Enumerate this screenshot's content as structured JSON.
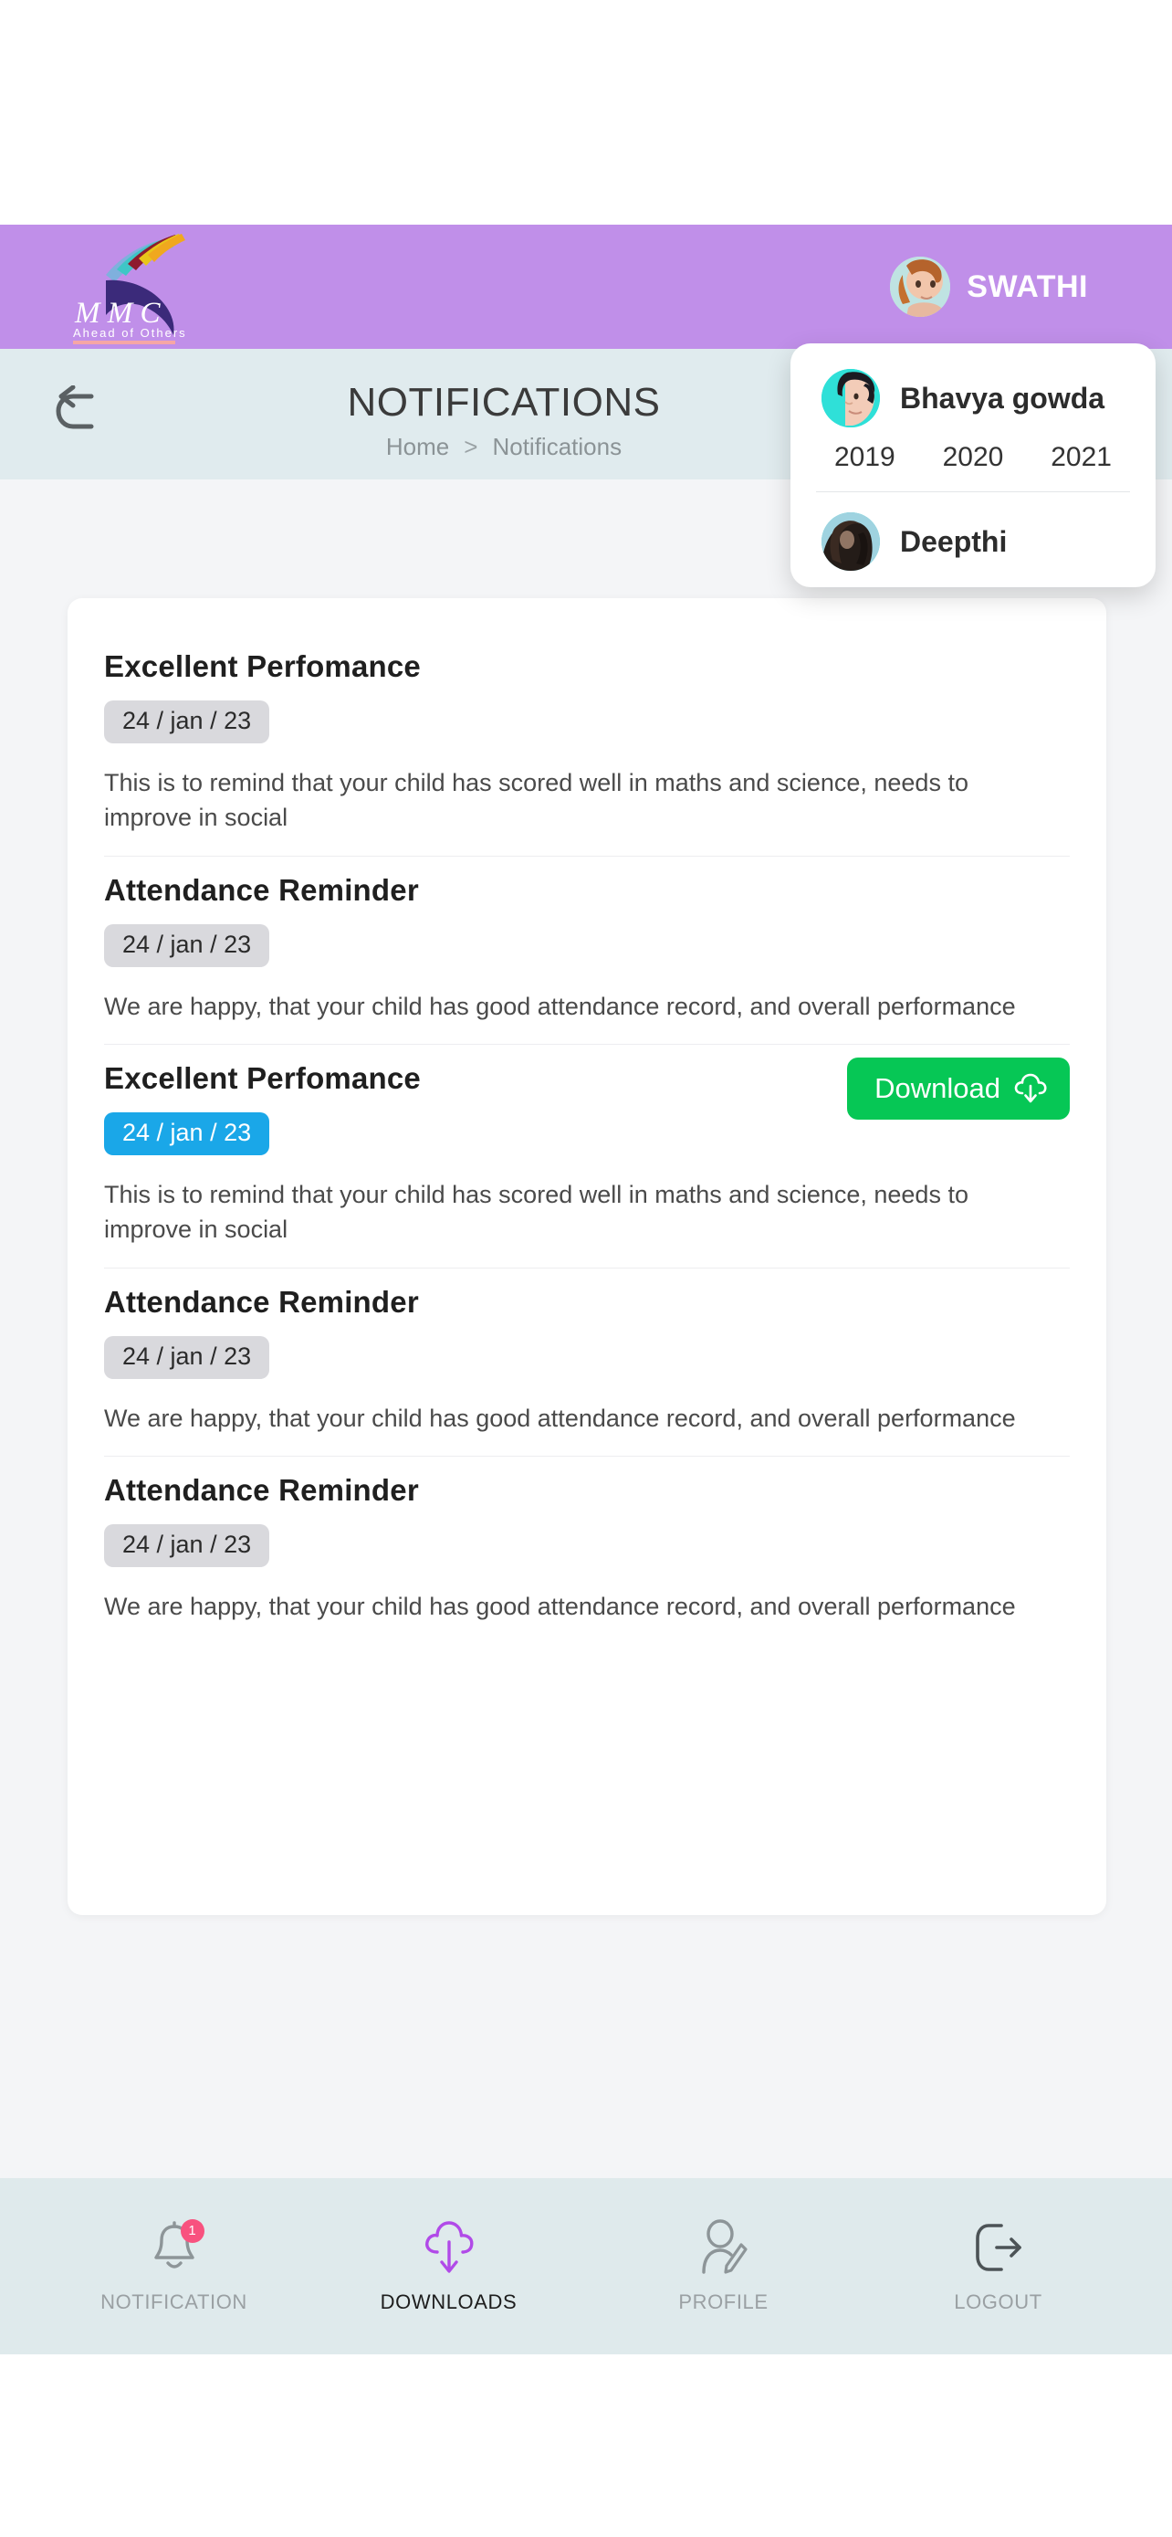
{
  "colors": {
    "header_purple": "#c08fe9",
    "titlebar_cyan": "#e0ebee",
    "page_bg": "#f4f5f7",
    "download_green": "#06c755",
    "active_badge_blue": "#1aa7e8",
    "badge_grey": "#d9d9dd",
    "nav_bg": "#dfeaec",
    "notification_badge_pink": "#f8527f",
    "downloads_purple": "#b14ae8"
  },
  "header": {
    "logo": {
      "name": "MMC",
      "tagline": "Ahead of Others",
      "icon": "mmc-logo"
    },
    "user": {
      "name": "SWATHI",
      "avatar": "swathi-avatar"
    }
  },
  "title_bar": {
    "back_icon": "back-arrow-icon",
    "title": "NOTIFICATIONS",
    "breadcrumb": {
      "home": "Home",
      "separator": ">",
      "current": "Notifications"
    }
  },
  "student_panel": {
    "students": [
      {
        "name": "Bhavya gowda",
        "avatar": "bhavya-avatar",
        "years": [
          "2019",
          "2020",
          "2021"
        ]
      },
      {
        "name": "Deepthi",
        "avatar": "deepthi-avatar"
      }
    ]
  },
  "notifications": [
    {
      "title": "Excellent Perfomance",
      "date": "24 / jan / 23",
      "date_active": false,
      "body": "This is to remind that your child has scored well in maths and science, needs to improve in social",
      "has_download": false
    },
    {
      "title": "Attendance Reminder",
      "date": "24 / jan / 23",
      "date_active": false,
      "body": "We are happy, that your child has good attendance record, and overall performance",
      "has_download": false
    },
    {
      "title": "Excellent Perfomance",
      "date": "24 / jan / 23",
      "date_active": true,
      "body": "This is to remind that your child has scored well in maths and science, needs to improve in social",
      "has_download": true,
      "download_label": "Download"
    },
    {
      "title": "Attendance Reminder",
      "date": "24 / jan / 23",
      "date_active": false,
      "body": "We are happy, that your child has good attendance record, and overall performance",
      "has_download": false
    },
    {
      "title": "Attendance Reminder",
      "date": "24 / jan / 23",
      "date_active": false,
      "body": "We are happy, that your child has good attendance record, and overall performance",
      "has_download": false
    }
  ],
  "bottom_nav": {
    "items": [
      {
        "label": "NOTIFICATION",
        "icon": "bell-icon",
        "active": false,
        "badge": "1"
      },
      {
        "label": "DOWNLOADS",
        "icon": "cloud-download-icon",
        "active": true
      },
      {
        "label": "PROFILE",
        "icon": "profile-edit-icon",
        "active": false
      },
      {
        "label": "LOGOUT",
        "icon": "logout-icon",
        "active": false
      }
    ]
  }
}
